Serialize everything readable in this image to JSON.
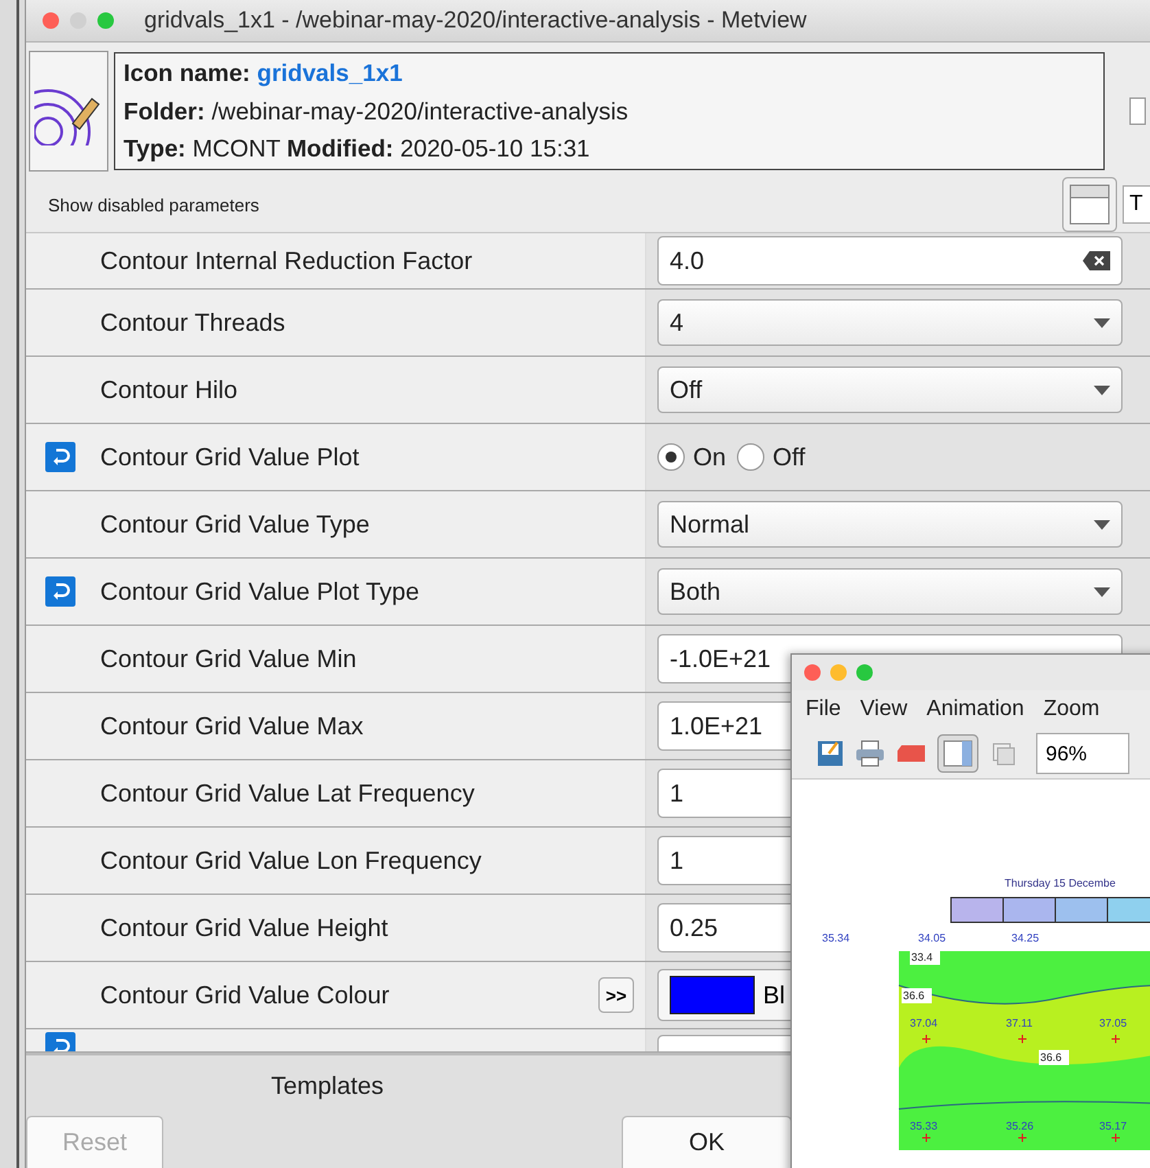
{
  "window": {
    "title": "gridvals_1x1 - /webinar-may-2020/interactive-analysis - Metview"
  },
  "info": {
    "icon_name_label": "Icon name:",
    "icon_name": "gridvals_1x1",
    "folder_label": "Folder:",
    "folder": "/webinar-may-2020/interactive-analysis",
    "type_label": "Type:",
    "type": "MCONT",
    "modified_label": "Modified:",
    "modified": "2020-05-10 15:31"
  },
  "options": {
    "show_disabled": "Show disabled parameters",
    "cut_button": "T"
  },
  "parameters": [
    {
      "label": "Contour Internal Reduction Factor",
      "kind": "text",
      "value": "4.0",
      "modified": false
    },
    {
      "label": "Contour Threads",
      "kind": "select",
      "value": "4",
      "modified": false
    },
    {
      "label": "Contour Hilo",
      "kind": "select",
      "value": "Off",
      "modified": false
    },
    {
      "label": "Contour Grid Value Plot",
      "kind": "radio",
      "modified": true,
      "options": [
        {
          "label": "On",
          "selected": true
        },
        {
          "label": "Off",
          "selected": false
        }
      ]
    },
    {
      "label": "Contour Grid Value Type",
      "kind": "select",
      "value": "Normal",
      "modified": false
    },
    {
      "label": "Contour Grid Value Plot Type",
      "kind": "select",
      "value": "Both",
      "modified": true
    },
    {
      "label": "Contour Grid Value Min",
      "kind": "text",
      "value": "-1.0E+21",
      "modified": false
    },
    {
      "label": "Contour Grid Value Max",
      "kind": "text",
      "value": "1.0E+21",
      "modified": false
    },
    {
      "label": "Contour Grid Value Lat Frequency",
      "kind": "text",
      "value": "1",
      "modified": false
    },
    {
      "label": "Contour Grid Value Lon Frequency",
      "kind": "text",
      "value": "1",
      "modified": false
    },
    {
      "label": "Contour Grid Value Height",
      "kind": "text",
      "value": "0.25",
      "modified": false
    },
    {
      "label": "Contour Grid Value Colour",
      "kind": "colour",
      "value": "Bl",
      "color": "#0000ff",
      "expand": ">>",
      "modified": false
    },
    {
      "kind": "partial",
      "modified": true
    }
  ],
  "templates": "Templates",
  "buttons": [
    {
      "label": "Reset",
      "disabled": true
    },
    {
      "label": "OK",
      "disabled": false
    }
  ],
  "plot_window": {
    "menu": [
      "File",
      "View",
      "Animation",
      "Zoom"
    ],
    "zoom": "96%",
    "plot_title": "Thursday 15 Decembe",
    "top_values": [
      "35.34",
      "34.05",
      "34.25"
    ],
    "contour_labels": [
      "33.4",
      "36.6",
      "36.6"
    ],
    "row_values": [
      [
        "37.04",
        "37.11",
        "37.05"
      ],
      [
        "35.33",
        "35.26",
        "35.17"
      ]
    ]
  }
}
